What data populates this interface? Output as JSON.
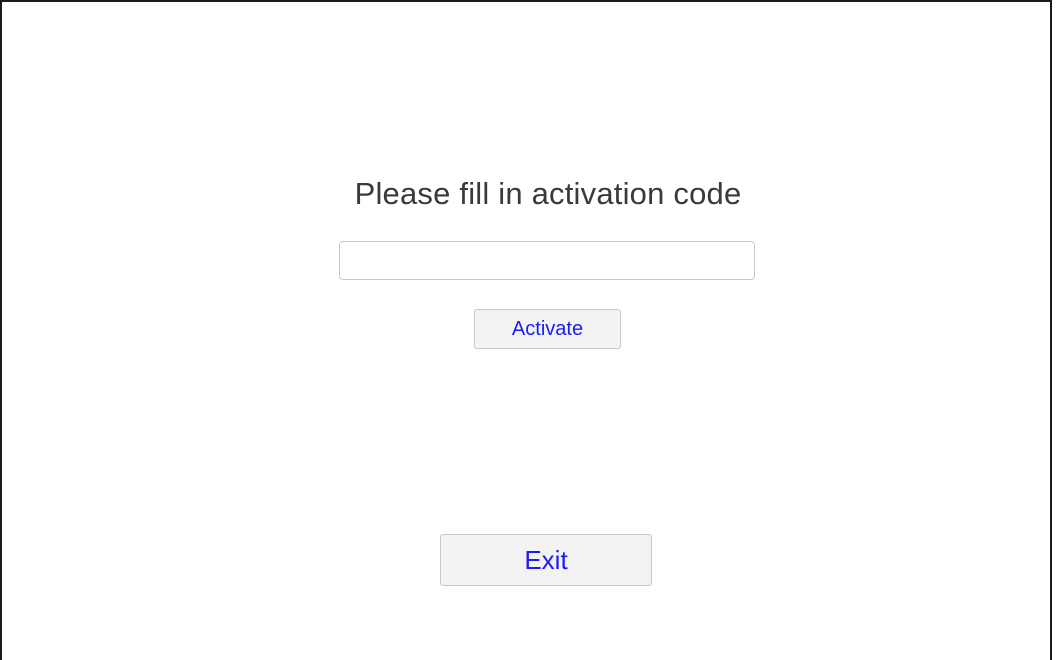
{
  "activation": {
    "prompt": "Please fill in activation code",
    "code_value": "",
    "code_placeholder": "",
    "activate_label": "Activate"
  },
  "footer": {
    "exit_label": "Exit"
  },
  "colors": {
    "button_text": "#1a1aff",
    "title_text": "#3a3a3a",
    "button_bg": "#f3f3f3"
  }
}
